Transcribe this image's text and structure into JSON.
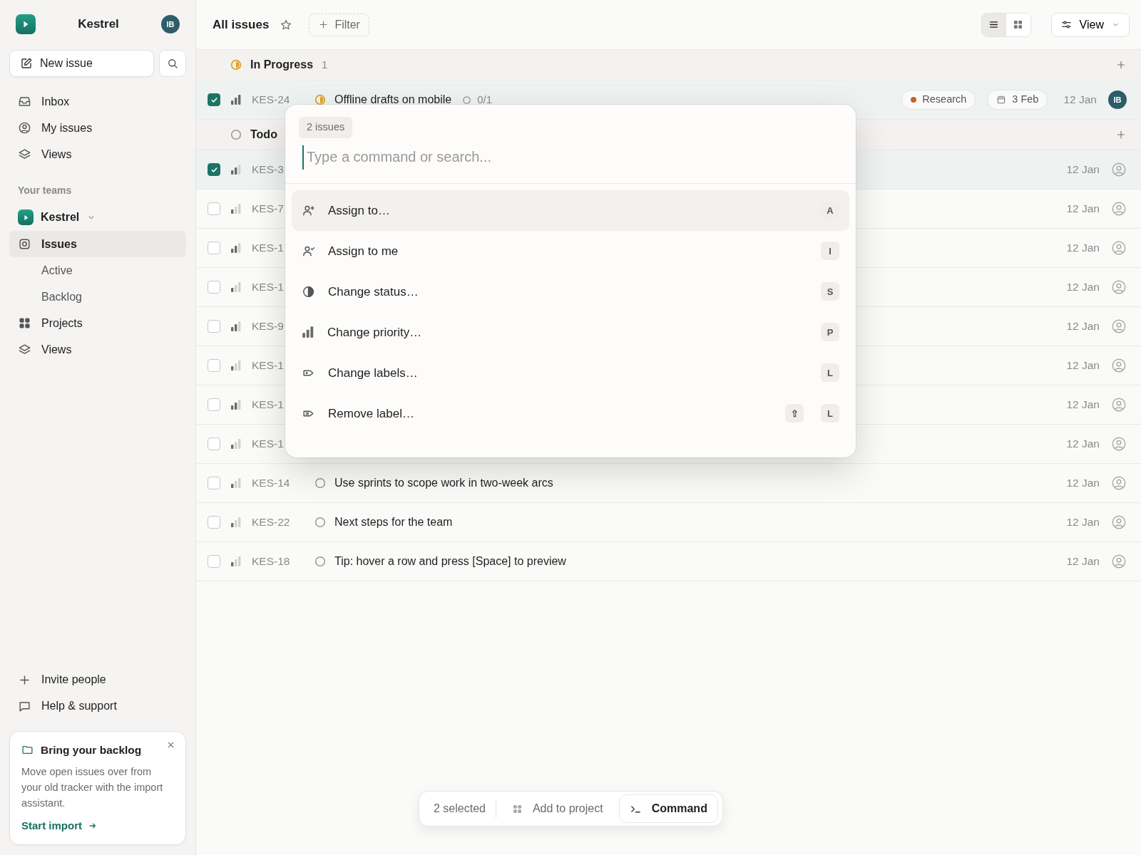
{
  "sidebar": {
    "workspace": "Kestrel",
    "avatar": "IB",
    "new_issue": "New issue",
    "nav": [
      {
        "label": "Inbox"
      },
      {
        "label": "My issues"
      },
      {
        "label": "Views"
      }
    ],
    "teams_heading": "Your teams",
    "team": {
      "name": "Kestrel",
      "expanded": true
    },
    "team_items": [
      {
        "kind": "main",
        "label": "Issues",
        "selected": true
      },
      {
        "kind": "sub",
        "label": "Active",
        "selected": false
      },
      {
        "kind": "sub",
        "label": "Backlog",
        "selected": false
      },
      {
        "kind": "main",
        "label": "Projects",
        "selected": false
      },
      {
        "kind": "main",
        "label": "Views",
        "selected": false
      }
    ],
    "footer_links": [
      {
        "label": "Invite people"
      },
      {
        "label": "Help & support"
      }
    ],
    "promo": {
      "title": "Bring your backlog",
      "body": "Move open issues over from your old tracker with the import assistant.",
      "action": "Start import"
    }
  },
  "header": {
    "title": "All issues",
    "starred": false,
    "filter": "Filter",
    "layouts": [
      {
        "kind": "list",
        "selected": true
      },
      {
        "kind": "board",
        "selected": false
      }
    ],
    "view": "View"
  },
  "groups": [
    {
      "kind": "started",
      "name": "In Progress",
      "count": "1",
      "issues": [
        {
          "id": "KES-24",
          "selected": true,
          "level": 1,
          "title": "Offline drafts on mobile",
          "sub_issues": "0/1",
          "label": {
            "name": "Research",
            "color": "#c2652a"
          },
          "due": "3 Feb",
          "created": "12 Jan",
          "assignee": "IB"
        }
      ]
    },
    {
      "kind": "unstarted",
      "name": "Todo",
      "issues": [
        {
          "id": "KES-3",
          "selected": true,
          "level": 0.67,
          "created": "12 Jan"
        },
        {
          "id": "KES-7",
          "selected": false,
          "level": 0.33,
          "created": "12 Jan"
        },
        {
          "id": "KES-1",
          "selected": false,
          "level": 0.67,
          "created": "12 Jan"
        },
        {
          "id": "KES-1",
          "selected": false,
          "level": 0.33,
          "created": "12 Jan"
        },
        {
          "id": "KES-9",
          "selected": false,
          "level": 0.67,
          "created": "12 Jan"
        },
        {
          "id": "KES-1",
          "selected": false,
          "level": 0.33,
          "created": "12 Jan"
        },
        {
          "id": "KES-1",
          "selected": false,
          "level": 0.67,
          "created": "12 Jan"
        },
        {
          "id": "KES-1",
          "selected": false,
          "level": 0.33,
          "created": "12 Jan"
        },
        {
          "id": "KES-14",
          "selected": false,
          "level": 0.33,
          "title": "Use sprints to scope work in two-week arcs",
          "created": "12 Jan"
        },
        {
          "id": "KES-22",
          "selected": false,
          "level": 0.33,
          "title": "Next steps for the team",
          "created": "12 Jan"
        },
        {
          "id": "KES-18",
          "selected": false,
          "level": 0.33,
          "title": "Tip: hover a row and press [Space] to preview",
          "created": "12 Jan"
        }
      ]
    }
  ],
  "palette": {
    "badge": "2 issues",
    "placeholder": "Type a command or search...",
    "commands": [
      {
        "label": "Assign to…",
        "keys": [
          "A"
        ],
        "selected": true
      },
      {
        "label": "Assign to me",
        "keys": [
          "I"
        ],
        "selected": false
      },
      {
        "label": "Change status…",
        "keys": [
          "S"
        ],
        "selected": false
      },
      {
        "label": "Change priority…",
        "keys": [
          "P"
        ],
        "selected": false
      },
      {
        "label": "Change labels…",
        "keys": [
          "L"
        ],
        "selected": false
      },
      {
        "label": "Remove label…",
        "keys": [
          "⇧",
          "L"
        ],
        "selected": false
      }
    ]
  },
  "selection_bar": {
    "count": "2 selected",
    "actions": [
      {
        "kind": "project",
        "label": "Add to project"
      },
      {
        "kind": "command",
        "label": "Command"
      }
    ]
  }
}
